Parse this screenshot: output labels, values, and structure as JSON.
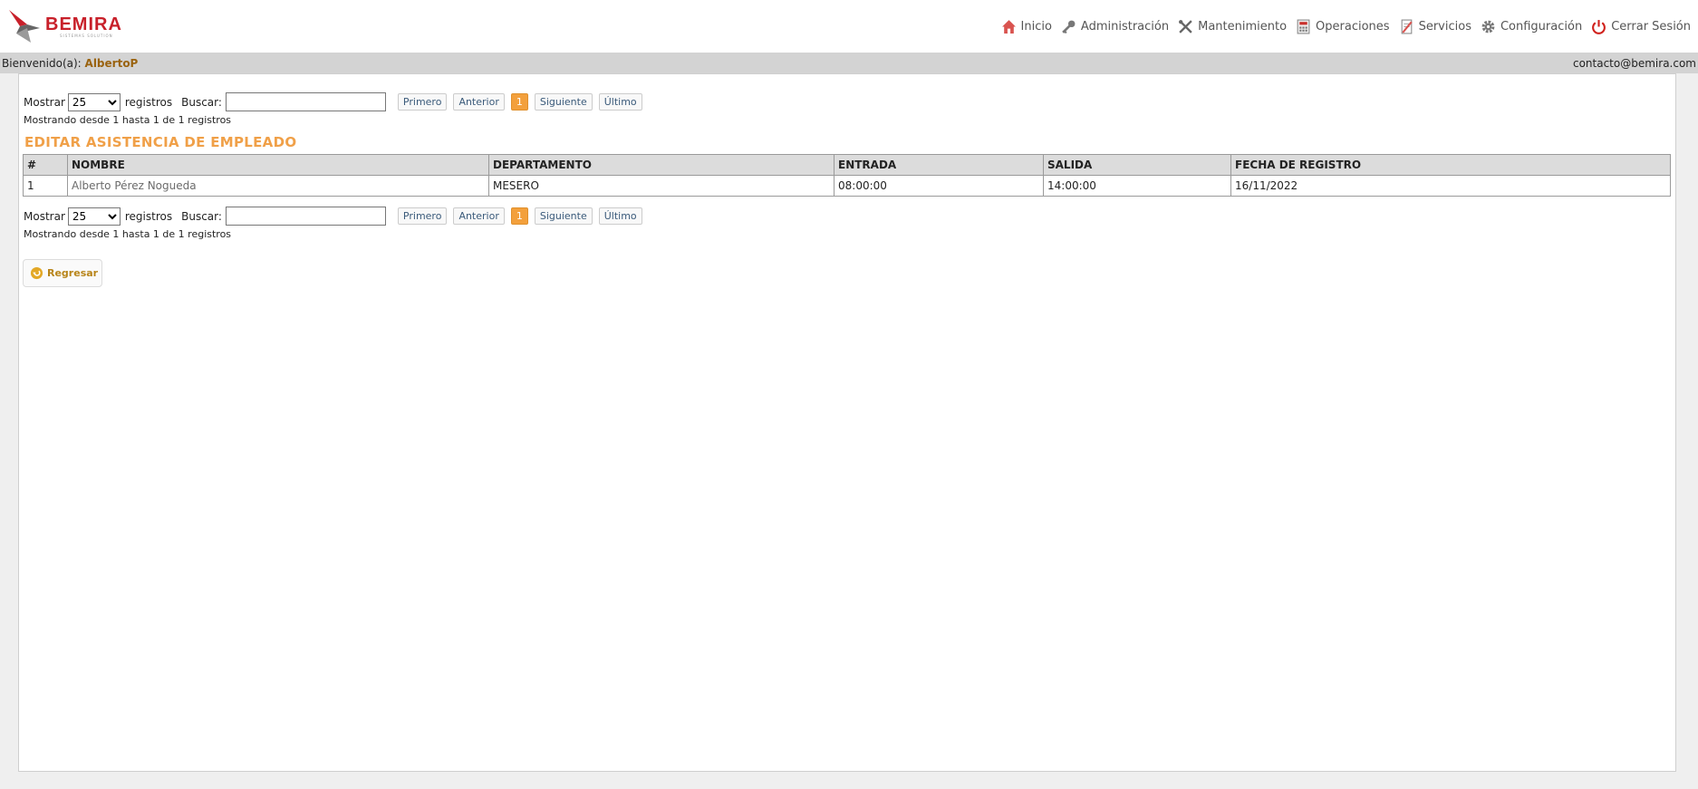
{
  "logo": {
    "name": "BEMIRA",
    "tagline": "SISTEMAS SOLUTION"
  },
  "nav": [
    {
      "label": "Inicio",
      "icon": "home-icon"
    },
    {
      "label": "Administración",
      "icon": "key-icon"
    },
    {
      "label": "Mantenimiento",
      "icon": "tools-icon"
    },
    {
      "label": "Operaciones",
      "icon": "calculator-icon"
    },
    {
      "label": "Servicios",
      "icon": "document-icon"
    },
    {
      "label": "Configuración",
      "icon": "gear-icon"
    },
    {
      "label": "Cerrar Sesión",
      "icon": "power-icon"
    }
  ],
  "userbar": {
    "welcome_label": "Bienvenido(a):",
    "username": "AlbertoP",
    "contact": "contacto@bemira.com"
  },
  "controls_top": {
    "show_label": "Mostrar",
    "show_value": "25",
    "records_label": "registros",
    "search_label": "Buscar:",
    "search_value": "",
    "pager": {
      "first": "Primero",
      "prev": "Anterior",
      "current": "1",
      "next": "Siguiente",
      "last": "Último"
    },
    "info": "Mostrando desde 1 hasta 1 de 1 registros"
  },
  "controls_bottom": {
    "show_label": "Mostrar",
    "show_value": "25",
    "records_label": "registros",
    "search_label": "Buscar:",
    "search_value": "",
    "pager": {
      "first": "Primero",
      "prev": "Anterior",
      "current": "1",
      "next": "Siguiente",
      "last": "Último"
    },
    "info": "Mostrando desde 1 hasta 1 de 1 registros"
  },
  "title": "EDITAR ASISTENCIA DE EMPLEADO",
  "table": {
    "headers": [
      "#",
      "NOMBRE",
      "DEPARTAMENTO",
      "ENTRADA",
      "SALIDA",
      "FECHA DE REGISTRO"
    ],
    "rows": [
      [
        "1",
        "Alberto Pérez Nogueda",
        "MESERO",
        "08:00:00",
        "14:00:00",
        "16/11/2022"
      ]
    ]
  },
  "back_button": {
    "label": "Regresar",
    "icon": "back-arrow-icon"
  },
  "colors": {
    "accent_orange": "#f0a048",
    "logo_red": "#c8202a",
    "user_brown": "#9a6310",
    "pager_current": "#f3a03c"
  }
}
